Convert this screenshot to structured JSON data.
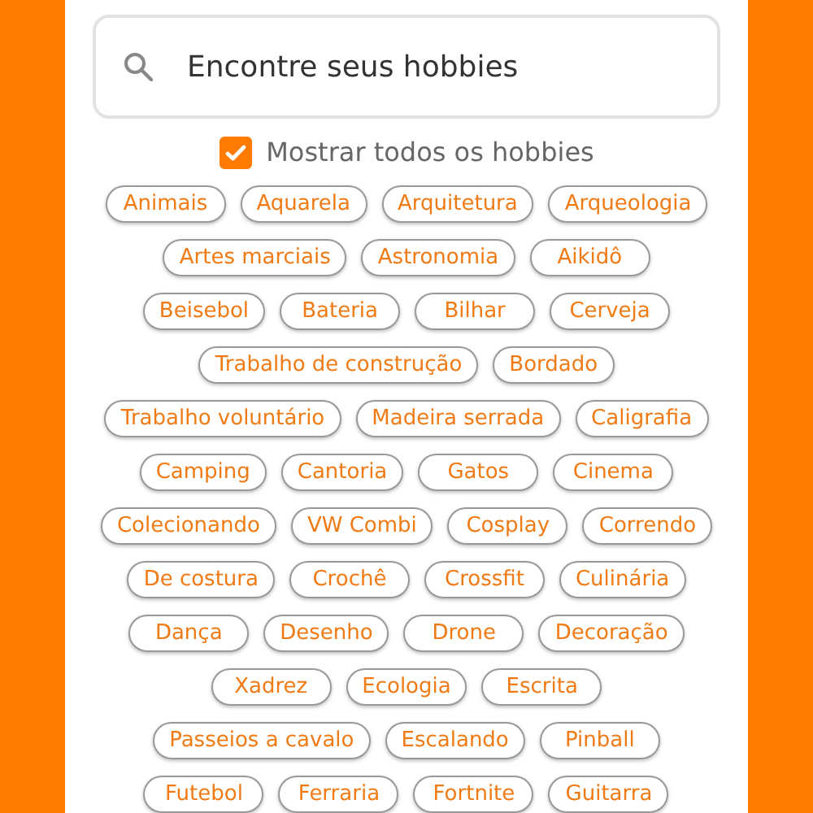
{
  "search": {
    "placeholder": "Encontre seus hobbies"
  },
  "show_all": {
    "label": "Mostrar todos os hobbies",
    "checked": true
  },
  "hobby_rows": [
    [
      {
        "label": "Animais",
        "selected": false
      },
      {
        "label": "Aquarela",
        "selected": false
      },
      {
        "label": "Arquitetura",
        "selected": false
      },
      {
        "label": "Arqueologia",
        "selected": false
      }
    ],
    [
      {
        "label": "Artes marciais",
        "selected": false
      },
      {
        "label": "Astronomia",
        "selected": false
      },
      {
        "label": "Aikidô",
        "selected": false
      }
    ],
    [
      {
        "label": "Beisebol",
        "selected": false
      },
      {
        "label": "Bateria",
        "selected": false
      },
      {
        "label": "Bilhar",
        "selected": false
      },
      {
        "label": "Cerveja",
        "selected": false
      }
    ],
    [
      {
        "label": "Trabalho de construção",
        "selected": false
      },
      {
        "label": "Bordado",
        "selected": false
      }
    ],
    [
      {
        "label": "Trabalho voluntário",
        "selected": false
      },
      {
        "label": "Madeira serrada",
        "selected": false
      },
      {
        "label": "Caligrafia",
        "selected": false
      }
    ],
    [
      {
        "label": "Camping",
        "selected": false
      },
      {
        "label": "Cantoria",
        "selected": false
      },
      {
        "label": "Gatos",
        "selected": false
      },
      {
        "label": "Cinema",
        "selected": false
      }
    ],
    [
      {
        "label": "Colecionando",
        "selected": false
      },
      {
        "label": "VW Combi",
        "selected": false
      },
      {
        "label": "Cosplay",
        "selected": false
      },
      {
        "label": "Correndo",
        "selected": false
      }
    ],
    [
      {
        "label": "De costura",
        "selected": false
      },
      {
        "label": "Crochê",
        "selected": false
      },
      {
        "label": "Crossfit",
        "selected": false
      },
      {
        "label": "Culinária",
        "selected": false
      }
    ],
    [
      {
        "label": "Dança",
        "selected": false
      },
      {
        "label": "Desenho",
        "selected": false
      },
      {
        "label": "Drone",
        "selected": false
      },
      {
        "label": "Decoração",
        "selected": false
      }
    ],
    [
      {
        "label": "Xadrez",
        "selected": false
      },
      {
        "label": "Ecologia",
        "selected": false
      },
      {
        "label": "Escrita",
        "selected": false
      }
    ],
    [
      {
        "label": "Passeios a cavalo",
        "selected": false
      },
      {
        "label": "Escalando",
        "selected": false
      },
      {
        "label": "Pinball",
        "selected": false
      }
    ],
    [
      {
        "label": "Futebol",
        "selected": false
      },
      {
        "label": "Ferraria",
        "selected": false
      },
      {
        "label": "Fortnite",
        "selected": false
      },
      {
        "label": "Guitarra",
        "selected": false
      }
    ]
  ]
}
